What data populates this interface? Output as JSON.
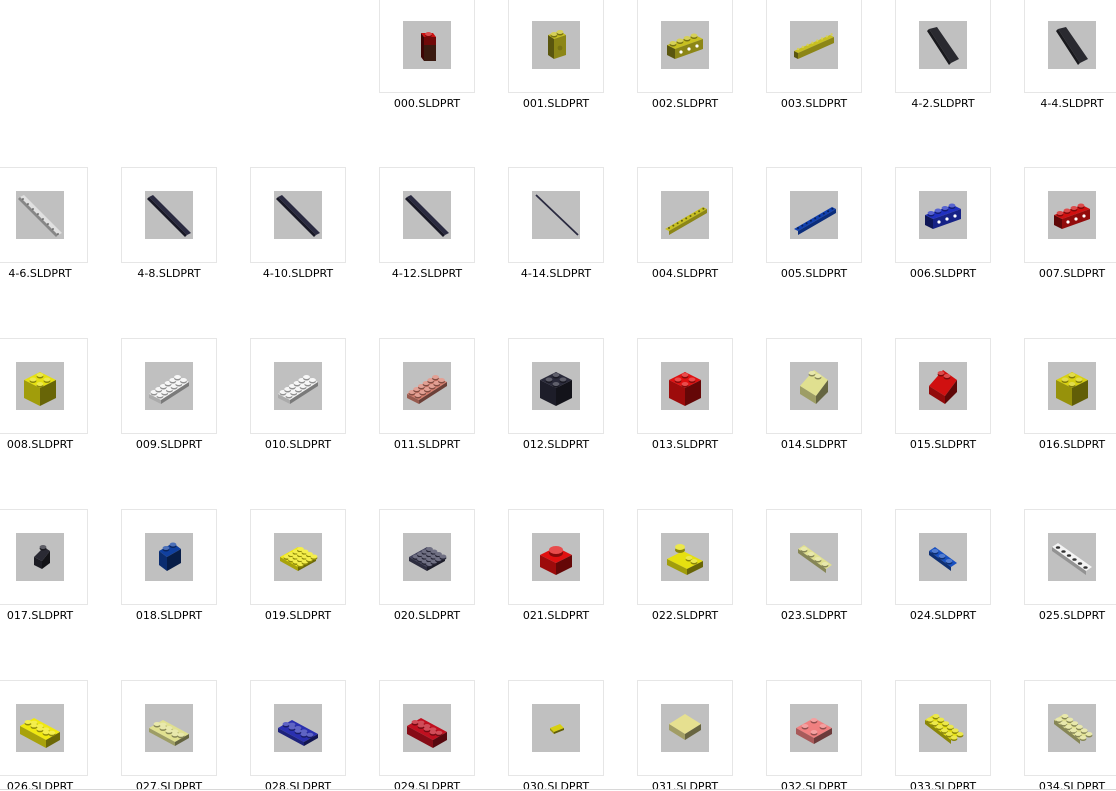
{
  "files": [
    {
      "name": "000.SLDPRT",
      "icon": "brick-1x1-tall",
      "color": "#cc1010"
    },
    {
      "name": "001.SLDPRT",
      "icon": "brick-1x2-side",
      "color": "#c8c020"
    },
    {
      "name": "002.SLDPRT",
      "icon": "brick-1x4",
      "color": "#c8c020"
    },
    {
      "name": "003.SLDPRT",
      "icon": "beam-1x8",
      "color": "#c8c020"
    },
    {
      "name": "4-2.SLDPRT",
      "icon": "axle-short",
      "color": "#2a2a30"
    },
    {
      "name": "4-4.SLDPRT",
      "icon": "axle-short",
      "color": "#2a2a30"
    },
    {
      "name": "4-6.SLDPRT",
      "icon": "axle-long",
      "color": "#e0e0e0"
    },
    {
      "name": "4-8.SLDPRT",
      "icon": "axle-long",
      "color": "#2a2a40"
    },
    {
      "name": "4-10.SLDPRT",
      "icon": "axle-long",
      "color": "#2a2a40"
    },
    {
      "name": "4-12.SLDPRT",
      "icon": "axle-long",
      "color": "#2a2a40"
    },
    {
      "name": "4-14.SLDPRT",
      "icon": "axle-thin",
      "color": "#2a2a40"
    },
    {
      "name": "004.SLDPRT",
      "icon": "beam-long",
      "color": "#c8c020"
    },
    {
      "name": "005.SLDPRT",
      "icon": "beam-long",
      "color": "#1040b0"
    },
    {
      "name": "006.SLDPRT",
      "icon": "brick-1x4",
      "color": "#2030c0"
    },
    {
      "name": "007.SLDPRT",
      "icon": "brick-1x4",
      "color": "#d01010"
    },
    {
      "name": "008.SLDPRT",
      "icon": "brick-2x2",
      "color": "#e6e010"
    },
    {
      "name": "009.SLDPRT",
      "icon": "plate-2x6",
      "color": "#f4f4f4"
    },
    {
      "name": "010.SLDPRT",
      "icon": "plate-2x6",
      "color": "#f4f4f4"
    },
    {
      "name": "011.SLDPRT",
      "icon": "plate-2x6",
      "color": "#d88070"
    },
    {
      "name": "012.SLDPRT",
      "icon": "brick-2x2",
      "color": "#2a2a3a"
    },
    {
      "name": "013.SLDPRT",
      "icon": "brick-2x2",
      "color": "#e01010"
    },
    {
      "name": "014.SLDPRT",
      "icon": "slope-2x2",
      "color": "#e0e090"
    },
    {
      "name": "015.SLDPRT",
      "icon": "slope-2x2",
      "color": "#d01010"
    },
    {
      "name": "016.SLDPRT",
      "icon": "brick-2x2",
      "color": "#d8d010"
    },
    {
      "name": "017.SLDPRT",
      "icon": "slope-1x2",
      "color": "#2a2a34"
    },
    {
      "name": "018.SLDPRT",
      "icon": "brick-1x2",
      "color": "#1040a0"
    },
    {
      "name": "019.SLDPRT",
      "icon": "plate-4x4",
      "color": "#f0e810"
    },
    {
      "name": "020.SLDPRT",
      "icon": "plate-4x4",
      "color": "#40405a"
    },
    {
      "name": "021.SLDPRT",
      "icon": "brick-2x2-round",
      "color": "#e01010"
    },
    {
      "name": "022.SLDPRT",
      "icon": "plate-2x3-round",
      "color": "#e6e010"
    },
    {
      "name": "023.SLDPRT",
      "icon": "plate-1x4",
      "color": "#e0e090"
    },
    {
      "name": "024.SLDPRT",
      "icon": "plate-1x3",
      "color": "#1850c0"
    },
    {
      "name": "025.SLDPRT",
      "icon": "plate-1x6",
      "color": "#f4f4f4"
    },
    {
      "name": "026.SLDPRT",
      "icon": "brick-2x4",
      "color": "#f0e810"
    },
    {
      "name": "027.SLDPRT",
      "icon": "plate-2x4",
      "color": "#e0e090"
    },
    {
      "name": "028.SLDPRT",
      "icon": "plate-2x4",
      "color": "#2a30b0"
    },
    {
      "name": "029.SLDPRT",
      "icon": "brick-2x4",
      "color": "#c01020"
    },
    {
      "name": "030.SLDPRT",
      "icon": "tile-small",
      "color": "#d8d010"
    },
    {
      "name": "031.SLDPRT",
      "icon": "tile-2x2",
      "color": "#e6e090"
    },
    {
      "name": "032.SLDPRT",
      "icon": "plate-2x2-round",
      "color": "#f08080"
    },
    {
      "name": "033.SLDPRT",
      "icon": "plate-2x6-diag",
      "color": "#e6e010"
    },
    {
      "name": "034.SLDPRT",
      "icon": "plate-2x6-diag",
      "color": "#e0e090"
    }
  ]
}
